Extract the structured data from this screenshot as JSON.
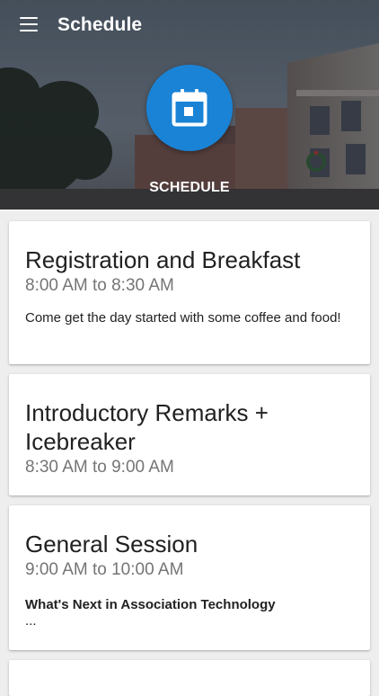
{
  "app_bar": {
    "title": "Schedule",
    "menu_icon": "hamburger-menu-icon"
  },
  "hero": {
    "icon": "calendar-icon",
    "label": "SCHEDULE",
    "accent_color": "#1a83d6"
  },
  "sessions": [
    {
      "title": "Registration and Breakfast",
      "time": "8:00 AM to 8:30 AM",
      "description": "Come get the day started with some coffee and food!"
    },
    {
      "title": "Introductory Remarks + Icebreaker",
      "time": "8:30 AM to 9:00 AM"
    },
    {
      "title": "General Session",
      "time": "9:00 AM to 10:00 AM",
      "subtitle": "What's Next in Association Technology",
      "description": "..."
    }
  ]
}
